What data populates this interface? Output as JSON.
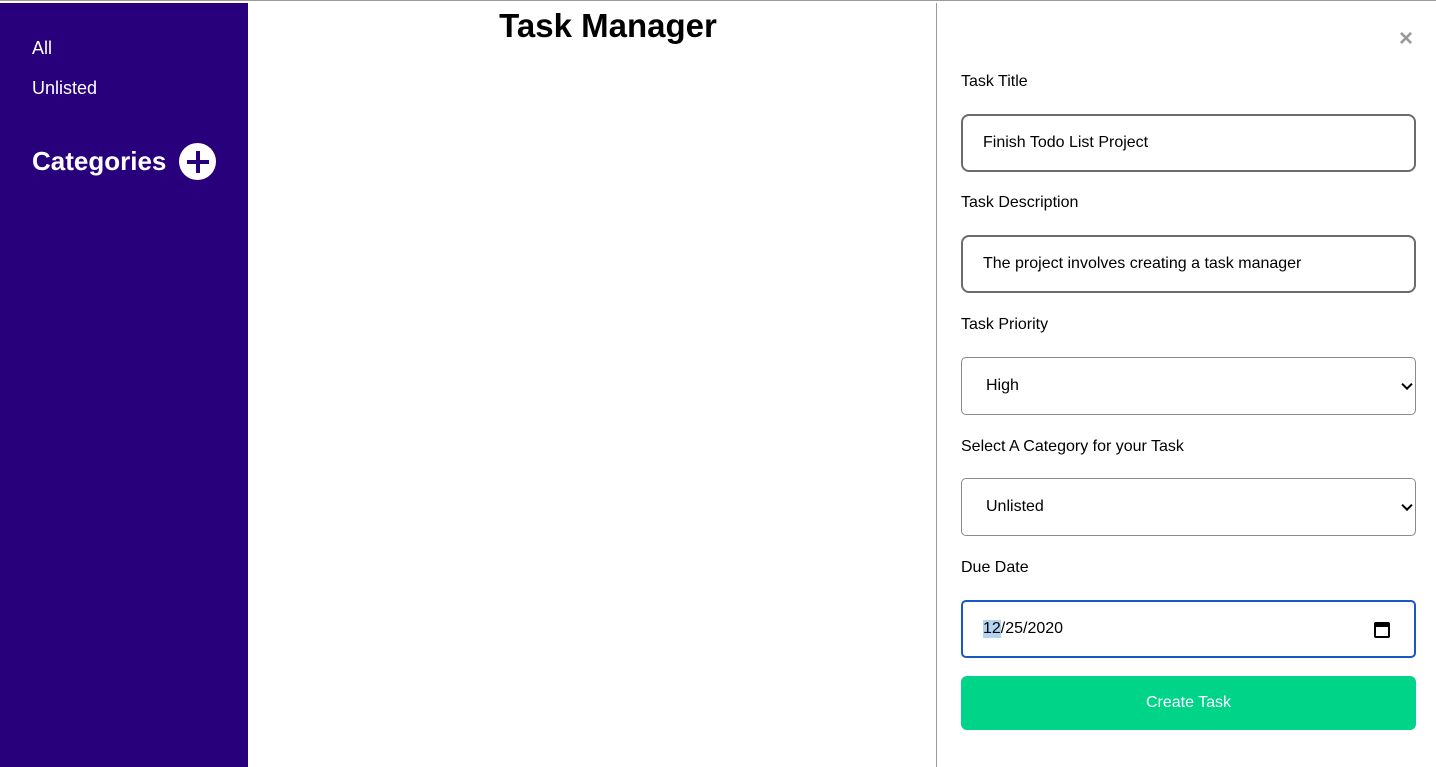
{
  "sidebar": {
    "items": [
      {
        "label": "All"
      },
      {
        "label": "Unlisted"
      }
    ],
    "categories_heading": "Categories",
    "add_icon": "plus-circle-icon",
    "bg_color": "#28007c"
  },
  "main": {
    "title": "Task Manager"
  },
  "panel": {
    "close_label": "×",
    "title_label": "Task Title",
    "title_value": "Finish Todo List Project",
    "description_label": "Task Description",
    "description_value": "The project involves creating a task manager",
    "priority_label": "Task Priority",
    "priority_value": "High",
    "category_label": "Select A Category for your Task",
    "category_value": "Unlisted",
    "due_label": "Due Date",
    "due_month": "12",
    "due_rest": "/25/2020",
    "calendar_icon": "calendar-icon",
    "create_label": "Create Task",
    "create_color": "#00d488"
  }
}
